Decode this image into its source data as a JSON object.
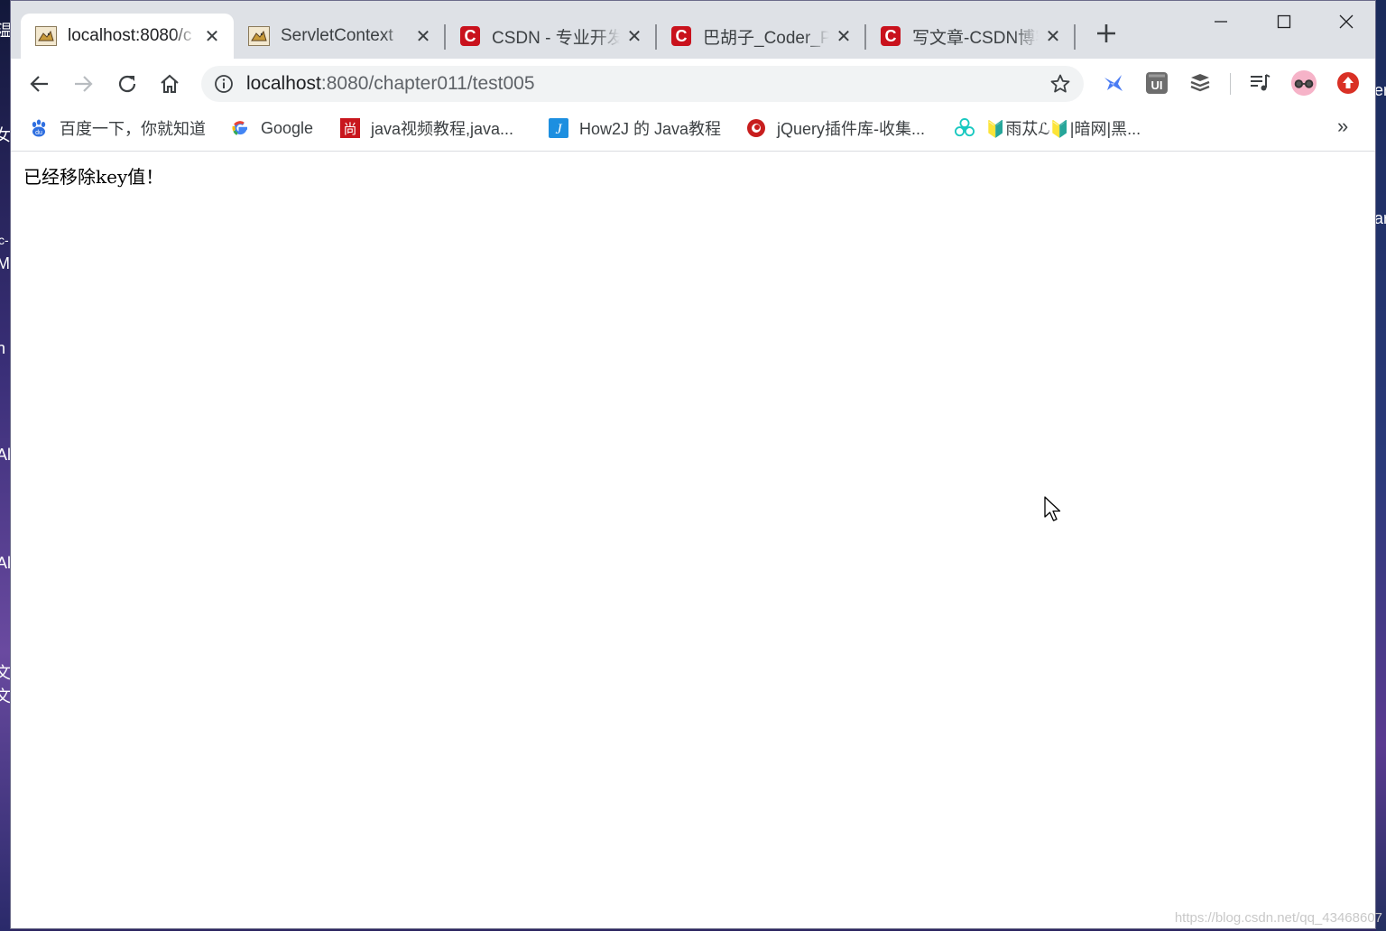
{
  "desktop": {
    "left_fragments": [
      "温",
      "女",
      "c-",
      "M",
      "n",
      "Al",
      "Al",
      "文",
      "文"
    ],
    "right_fragments": [
      "er",
      "ar"
    ]
  },
  "tabs": [
    {
      "title": "localhost:8080/c",
      "favicon": "tomcat-icon",
      "active": true
    },
    {
      "title": "ServletContext",
      "favicon": "tomcat-icon",
      "active": false
    },
    {
      "title": "CSDN - 专业开发",
      "favicon": "csdn-icon",
      "active": false
    },
    {
      "title": "巴胡子_Coder_Pl",
      "favicon": "csdn-icon",
      "active": false
    },
    {
      "title": "写文章-CSDN博客",
      "favicon": "csdn-icon",
      "active": false
    }
  ],
  "omnibox": {
    "host": "localhost",
    "rest": ":8080/chapter011/test005"
  },
  "bookmarks": [
    {
      "label": "百度一下，你就知道",
      "icon": "baidu-paw-icon"
    },
    {
      "label": "Google",
      "icon": "google-g-icon"
    },
    {
      "label": "java视频教程,java...",
      "icon": "shang-icon"
    },
    {
      "label": "How2J 的 Java教程",
      "icon": "how2j-icon"
    },
    {
      "label": "jQuery插件库-收集...",
      "icon": "jquery-icon"
    },
    {
      "label": "🔰雨苁ℒ🔰|暗网|黑...",
      "icon": "biohazard-icon"
    }
  ],
  "bookmarks_more": "»",
  "page": {
    "message": "已经移除key值！"
  },
  "watermark": "https://blog.csdn.net/qq_43468607",
  "colors": {
    "tabstrip_bg": "#dee1e6",
    "omnibox_bg": "#f1f3f4",
    "csdn_red": "#c9121d"
  }
}
